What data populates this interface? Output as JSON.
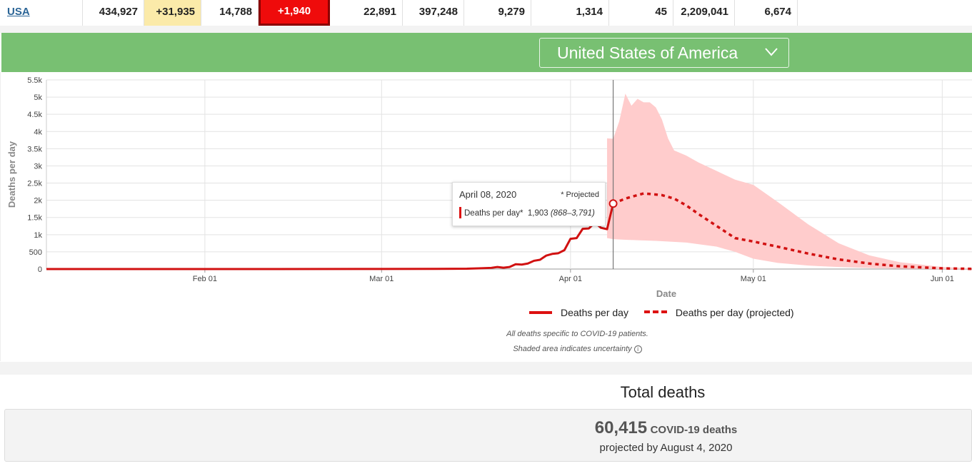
{
  "stats_row": {
    "country": "USA",
    "values": [
      "434,927",
      "+31,935",
      "14,788",
      "+1,940",
      "22,891",
      "397,248",
      "9,279",
      "1,314",
      "45",
      "2,209,041",
      "6,674"
    ]
  },
  "selector": {
    "country": "United States of America",
    "icon": "chevron-down-icon"
  },
  "chart_data": {
    "type": "line",
    "ylabel": "Deaths per day",
    "xlabel": "Date",
    "y_ticks": [
      "0",
      "500",
      "1k",
      "1.5k",
      "2k",
      "2.5k",
      "3k",
      "3.5k",
      "4k",
      "4.5k",
      "5k",
      "5.5k"
    ],
    "ylim": [
      0,
      5500
    ],
    "x_ticks": [
      "Feb 01",
      "Mar 01",
      "Apr 01",
      "May 01",
      "Jun 01"
    ],
    "x_range": [
      "2020-01-06",
      "2020-06-06"
    ],
    "current_date": "2020-04-08",
    "series": [
      {
        "name": "Deaths per day",
        "style": "solid",
        "color": "#d11111",
        "points": [
          [
            "2020-01-06",
            0
          ],
          [
            "2020-02-01",
            0
          ],
          [
            "2020-03-01",
            2
          ],
          [
            "2020-03-10",
            5
          ],
          [
            "2020-03-15",
            10
          ],
          [
            "2020-03-17",
            20
          ],
          [
            "2020-03-19",
            35
          ],
          [
            "2020-03-20",
            60
          ],
          [
            "2020-03-21",
            40
          ],
          [
            "2020-03-22",
            60
          ],
          [
            "2020-03-23",
            140
          ],
          [
            "2020-03-24",
            130
          ],
          [
            "2020-03-25",
            160
          ],
          [
            "2020-03-26",
            240
          ],
          [
            "2020-03-27",
            270
          ],
          [
            "2020-03-28",
            390
          ],
          [
            "2020-03-29",
            440
          ],
          [
            "2020-03-30",
            460
          ],
          [
            "2020-03-31",
            550
          ],
          [
            "2020-04-01",
            880
          ],
          [
            "2020-04-02",
            900
          ],
          [
            "2020-04-03",
            1170
          ],
          [
            "2020-04-04",
            1180
          ],
          [
            "2020-04-05",
            1350
          ],
          [
            "2020-04-06",
            1200
          ],
          [
            "2020-04-07",
            1160
          ],
          [
            "2020-04-08",
            1903
          ]
        ]
      },
      {
        "name": "Deaths per day (projected)",
        "style": "dashed",
        "color": "#d11111",
        "points": [
          [
            "2020-04-08",
            1903
          ],
          [
            "2020-04-10",
            2050
          ],
          [
            "2020-04-12",
            2150
          ],
          [
            "2020-04-13",
            2200
          ],
          [
            "2020-04-16",
            2150
          ],
          [
            "2020-04-18",
            2050
          ],
          [
            "2020-04-20",
            1850
          ],
          [
            "2020-04-22",
            1600
          ],
          [
            "2020-04-25",
            1250
          ],
          [
            "2020-04-28",
            900
          ],
          [
            "2020-05-01",
            800
          ],
          [
            "2020-05-05",
            650
          ],
          [
            "2020-05-10",
            450
          ],
          [
            "2020-05-15",
            280
          ],
          [
            "2020-05-20",
            160
          ],
          [
            "2020-05-25",
            80
          ],
          [
            "2020-06-01",
            20
          ],
          [
            "2020-06-06",
            5
          ]
        ]
      }
    ],
    "uncertainty_band": {
      "color": "#ffcccc",
      "upper": [
        [
          "2020-04-07",
          3800
        ],
        [
          "2020-04-08",
          3791
        ],
        [
          "2020-04-09",
          4300
        ],
        [
          "2020-04-10",
          5100
        ],
        [
          "2020-04-11",
          4750
        ],
        [
          "2020-04-12",
          4950
        ],
        [
          "2020-04-13",
          4850
        ],
        [
          "2020-04-14",
          4850
        ],
        [
          "2020-04-15",
          4700
        ],
        [
          "2020-04-16",
          4350
        ],
        [
          "2020-04-17",
          3800
        ],
        [
          "2020-04-18",
          3450
        ],
        [
          "2020-04-20",
          3300
        ],
        [
          "2020-04-22",
          3100
        ],
        [
          "2020-04-25",
          2850
        ],
        [
          "2020-04-28",
          2600
        ],
        [
          "2020-05-01",
          2450
        ],
        [
          "2020-05-05",
          1950
        ],
        [
          "2020-05-10",
          1300
        ],
        [
          "2020-05-15",
          750
        ],
        [
          "2020-05-20",
          400
        ],
        [
          "2020-05-25",
          200
        ],
        [
          "2020-06-01",
          60
        ],
        [
          "2020-06-06",
          20
        ]
      ],
      "lower": [
        [
          "2020-06-06",
          0
        ],
        [
          "2020-06-01",
          0
        ],
        [
          "2020-05-25",
          10
        ],
        [
          "2020-05-20",
          30
        ],
        [
          "2020-05-15",
          60
        ],
        [
          "2020-05-10",
          100
        ],
        [
          "2020-05-05",
          180
        ],
        [
          "2020-05-01",
          300
        ],
        [
          "2020-04-28",
          500
        ],
        [
          "2020-04-25",
          650
        ],
        [
          "2020-04-20",
          770
        ],
        [
          "2020-04-15",
          820
        ],
        [
          "2020-04-10",
          850
        ],
        [
          "2020-04-08",
          868
        ],
        [
          "2020-04-07",
          900
        ]
      ]
    }
  },
  "tooltip": {
    "date": "April 08, 2020",
    "projected": "* Projected",
    "series": "Deaths per day*",
    "value": "1,903",
    "range": "(868–3,791)"
  },
  "legend": {
    "actual": "Deaths per day",
    "projected": "Deaths per day (projected)"
  },
  "notes": {
    "line1": "All deaths specific to COVID-19 patients.",
    "line2": "Shaded area indicates uncertainty",
    "info_icon": "info-icon"
  },
  "total": {
    "title": "Total deaths",
    "number": "60,415",
    "label": "COVID-19 deaths",
    "subline": "projected by August 4, 2020"
  }
}
